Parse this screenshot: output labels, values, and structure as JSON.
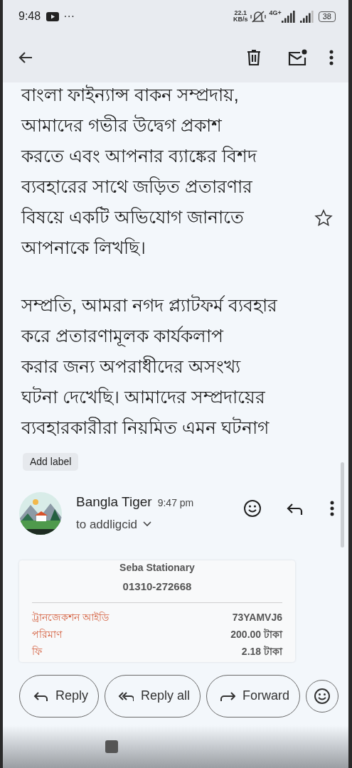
{
  "status_bar": {
    "time": "9:48",
    "more": "···",
    "net_speed": "22.1",
    "net_unit": "KB/s",
    "network": "4G+",
    "battery": "38"
  },
  "body": {
    "starred": false,
    "paragraphs": [
      [
        "বাংলা ফাইন্যান্স বাকন সম্প্রদায়,",
        "আমাদের গভীর উদ্বেগ প্রকাশ",
        "করতে এবং আপনার ব্যাঙ্কের বিশদ",
        "ব্যবহারের সাথে জড়িত প্রতারণার",
        "বিষয়ে একটি অভিযোগ জানাতে",
        "আপনাকে লিখছি।"
      ],
      [
        "সম্প্রতি, আমরা নগদ প্ল্যাটফর্ম ব্যবহার",
        "করে প্রতারণামূলক কার্যকলাপ",
        "করার জন্য অপরাধীদের অসংখ্য",
        "ঘটনা দেখেছি। আমাদের সম্প্রদায়ের",
        "ব্যবহারকারীরা নিয়মিত এমন ঘটনাগ"
      ]
    ]
  },
  "label_chip": "Add label",
  "sender": {
    "name": "Bangla Tiger",
    "time": "9:47 pm",
    "to": "to addligcid"
  },
  "receipt": {
    "merchant": "Seba Stationary",
    "phone": "01310-272668",
    "rows": [
      {
        "label": "ট্রানজেকশন আইডি",
        "value": "73YAMVJ6"
      },
      {
        "label": "পরিমাণ",
        "value": "200.00 টাকা"
      },
      {
        "label": "ফি",
        "value": "2.18 টাকা"
      }
    ]
  },
  "actions": [
    {
      "kind": "reply",
      "label": "Reply"
    },
    {
      "kind": "reply_all",
      "label": "Reply all"
    },
    {
      "kind": "forward",
      "label": "Forward"
    },
    {
      "kind": "react"
    }
  ]
}
